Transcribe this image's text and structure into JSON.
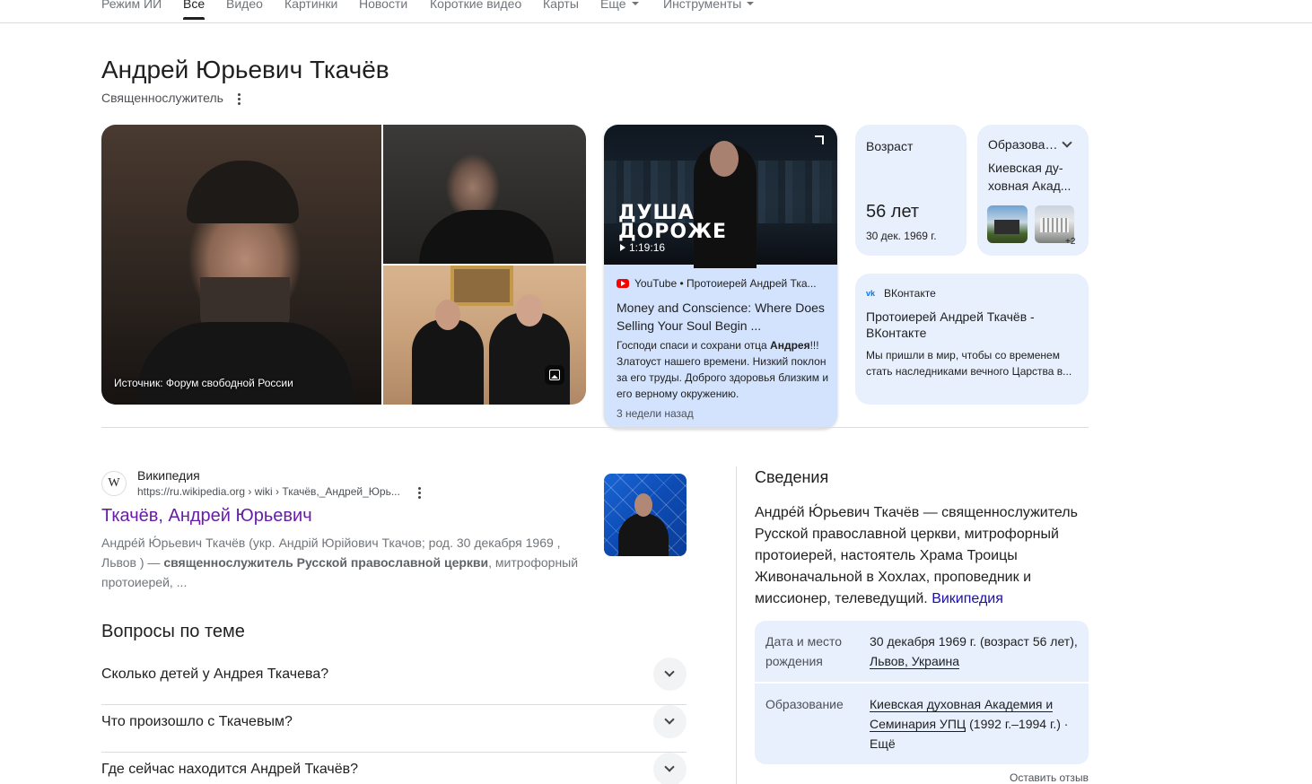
{
  "nav": {
    "items": [
      "Режим ИИ",
      "Все",
      "Видео",
      "Картинки",
      "Новости",
      "Короткие видео",
      "Карты",
      "Еще",
      "Инструменты"
    ],
    "active": "Все"
  },
  "entity": {
    "title": "Андрей Юрьевич Ткачёв",
    "subtitle": "Священнослужитель"
  },
  "images": {
    "caption": "Источник: Форум свободной России"
  },
  "video": {
    "headline_line1": "ДУША",
    "headline_line2": "ДОРОЖЕ",
    "duration": "1:19:16",
    "source": "YouTube • Протоиерей Андрей Тка...",
    "title": "Money and Conscience: Where Does Selling Your Soul Begin ...",
    "snippet_pre": "Господи спаси и сохрани отца ",
    "snippet_bold": "Андрея",
    "snippet_post": "!!! Златоуст нашего времени. Низкий поклон за его труды. Доброго здоровья близким и его верному окружению.",
    "date": "3 недели назад"
  },
  "age": {
    "label": "Возраст",
    "value": "56 лет",
    "date": "30 дек. 1969 г."
  },
  "education": {
    "label": "Образование",
    "value": "Киевская ду-ховная Акад...",
    "more": "+2"
  },
  "vk": {
    "source": "ВКонтакте",
    "title": "Протоиерей Андрей Ткачёв - ВКонтакте",
    "snippet": "Мы пришли в мир, чтобы со временем стать наследниками вечного Царства в..."
  },
  "wiki": {
    "favicon": "W",
    "site": "Википедия",
    "url": "https://ru.wikipedia.org › wiki › Ткачёв,_Андрей_Юрь...",
    "title": "Ткачёв, Андрей Юрьевич",
    "snippet_pre": "Андре́й Ю́рьевич Ткачёв (укр. Андрій Юрійович Ткачов; род. 30 декабря 1969 , Львов ) — ",
    "snippet_bold": "священнослужитель Русской православной церкви",
    "snippet_post": ", митрофорный протоиерей, ..."
  },
  "questions": {
    "heading": "Вопросы по теме",
    "items": [
      "Сколько детей у Андрея Ткачева?",
      "Что произошло с Ткачевым?",
      "Где сейчас находится Андрей Ткачёв?"
    ]
  },
  "knowledge_panel": {
    "heading": "Сведения",
    "description": "Андре́й Ю́рьевич Ткачёв — священнослужитель Русской православной церкви, митрофорный протоиерей, настоятель Храма Троицы Живоначальной в Хохлах, проповедник и миссионер, телеведущий.",
    "description_link": "Википедия",
    "facts": [
      {
        "key": "Дата и место рождения",
        "value_pre": "30 декабря 1969 г. (возраст 56 лет), ",
        "value_link": "Львов, Украина",
        "value_post": ""
      },
      {
        "key": "Образование",
        "value_pre": "",
        "value_link": "Киевская духовная Академия и Семинария УПЦ",
        "value_post": " (1992 г.–1994 г.) · Ещё"
      }
    ],
    "feedback": "Оставить отзыв"
  },
  "colors": {
    "link_visited": "#681da8",
    "link": "#1a0dab",
    "card_bg": "#e8f0fe",
    "video_card_bg": "#d3e3fd"
  }
}
